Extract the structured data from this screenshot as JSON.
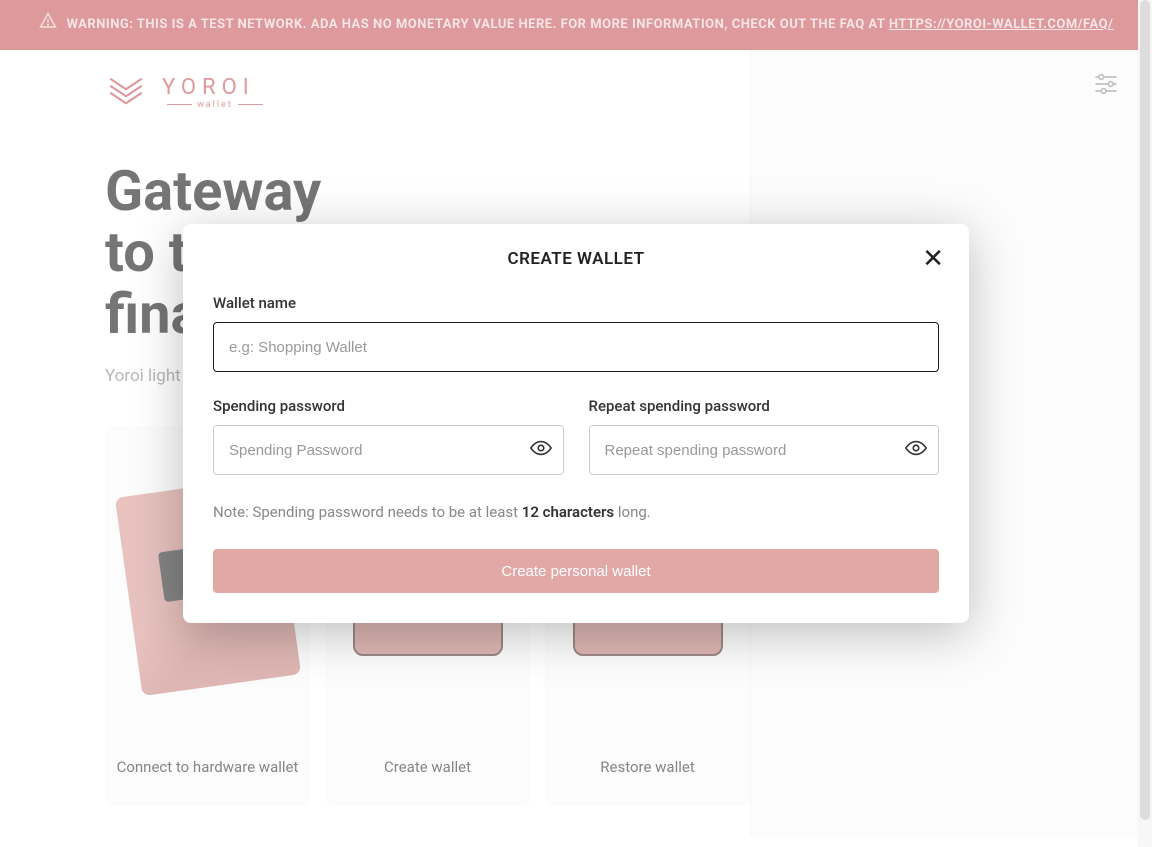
{
  "banner": {
    "text_prefix": "WARNING: THIS IS A TEST NETWORK. ADA HAS NO MONETARY VALUE HERE. FOR MORE INFORMATION, CHECK OUT THE FAQ AT ",
    "link_text": "HTTPS://YOROI-WALLET.COM/FAQ/"
  },
  "logo": {
    "name": "YOROI",
    "sub": "wallet"
  },
  "headline": {
    "line1": "Gateway",
    "line2": "to the",
    "line3": "financial world",
    "full": "Gateway to the financial world"
  },
  "subhead": "Yoroi light wallet for Cardano assets",
  "cards": [
    {
      "label": "Connect to hardware wallet"
    },
    {
      "label": "Create wallet"
    },
    {
      "label": "Restore wallet"
    }
  ],
  "modal": {
    "title": "CREATE WALLET",
    "wallet_name_label": "Wallet name",
    "wallet_name_placeholder": "e.g: Shopping Wallet",
    "spending_pw_label": "Spending password",
    "spending_pw_placeholder": "Spending Password",
    "repeat_pw_label": "Repeat spending password",
    "repeat_pw_placeholder": "Repeat spending password",
    "note_prefix": "Note: Spending password needs to be at least ",
    "note_strong": "12 characters",
    "note_suffix": " long.",
    "button": "Create personal wallet"
  },
  "colors": {
    "accent": "#c6565a",
    "button_disabled": "#e1a8a6"
  }
}
